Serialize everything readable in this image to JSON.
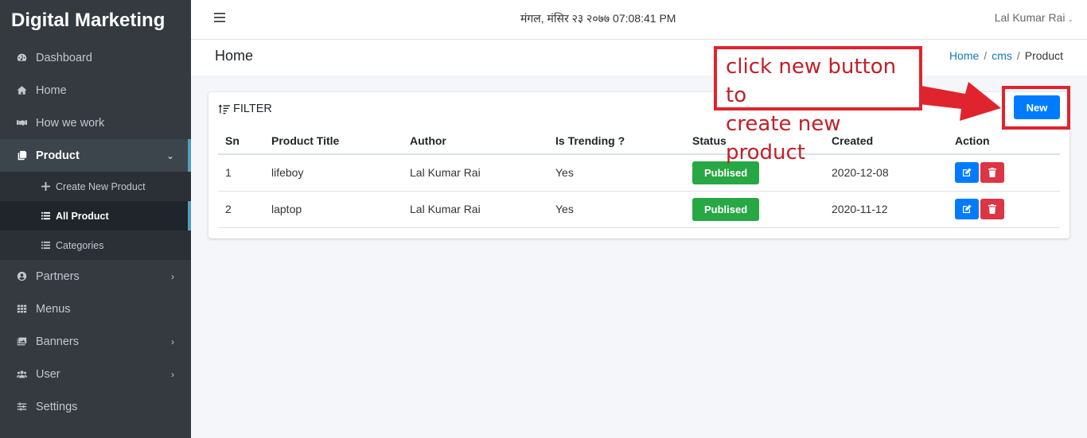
{
  "brand": "Digital Marketing",
  "sidebar": {
    "items": [
      {
        "label": "Dashboard"
      },
      {
        "label": "Home"
      },
      {
        "label": "How we work"
      },
      {
        "label": "Product"
      },
      {
        "label": "Partners"
      },
      {
        "label": "Menus"
      },
      {
        "label": "Banners"
      },
      {
        "label": "User"
      },
      {
        "label": "Settings"
      }
    ],
    "product_sub": [
      {
        "label": "Create New Product"
      },
      {
        "label": "All Product"
      },
      {
        "label": "Categories"
      }
    ]
  },
  "topbar": {
    "datetime": "मंगल, मंसिर २३ २०७७ 07:08:41 PM",
    "user": "Lal Kumar Rai"
  },
  "header": {
    "title": "Home",
    "breadcrumb": [
      "Home",
      "cms",
      "Product"
    ]
  },
  "card": {
    "filter_label": "FILTER",
    "new_label": "New"
  },
  "table": {
    "columns": [
      "Sn",
      "Product Title",
      "Author",
      "Is Trending ?",
      "Status",
      "Created",
      "Action"
    ],
    "rows": [
      {
        "sn": "1",
        "title": "lifeboy",
        "author": "Lal Kumar Rai",
        "trending": "Yes",
        "status": "Publised",
        "created": "2020-12-08"
      },
      {
        "sn": "2",
        "title": "laptop",
        "author": "Lal Kumar Rai",
        "trending": "Yes",
        "status": "Publised",
        "created": "2020-11-12"
      }
    ]
  },
  "annotation": {
    "line1": "click new button to",
    "line2": "create new product"
  }
}
